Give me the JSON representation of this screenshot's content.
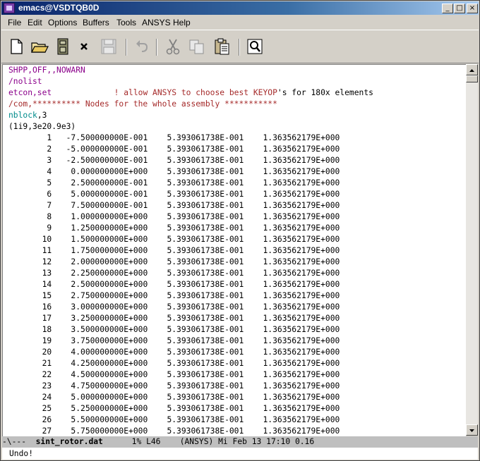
{
  "window": {
    "title": "emacs@VSDTQB0D"
  },
  "title_buttons": {
    "minimize": "_",
    "maximize": "□",
    "close": "×"
  },
  "menu": [
    "File",
    "Edit",
    "Options",
    "Buffers",
    "Tools",
    "ANSYS",
    "Help"
  ],
  "toolbar": [
    "new-file-icon",
    "open-folder-icon",
    "save-icon",
    "close-icon",
    "disk-icon",
    "undo-icon",
    "cut-icon",
    "copy-icon",
    "paste-icon",
    "search-icon"
  ],
  "colors": {
    "keyword": "#8b008b",
    "command": "#008b8b",
    "comment": "#a52a2a",
    "text": "#000000"
  },
  "header_lines": [
    {
      "parts": [
        {
          "t": "SHPP,OFF,,NOWARN",
          "c": "keyword"
        }
      ]
    },
    {
      "parts": [
        {
          "t": "/nolist",
          "c": "keyword"
        }
      ]
    },
    {
      "parts": [
        {
          "t": "etcon,set",
          "c": "keyword"
        },
        {
          "t": "             ! allow ANSYS to choose best KEYOP",
          "c": "comment"
        },
        {
          "t": "'s for 180x elements",
          "c": "text"
        }
      ]
    },
    {
      "parts": [
        {
          "t": "/com,********** Nodes for the whole assembly ***********",
          "c": "comment"
        }
      ]
    },
    {
      "parts": [
        {
          "t": "nblock",
          "c": "command"
        },
        {
          "t": ",3",
          "c": "text"
        }
      ]
    },
    {
      "parts": [
        {
          "t": "(1i9,3e20.9e3)",
          "c": "text"
        }
      ]
    }
  ],
  "nodes": [
    {
      "id": "1",
      "x": "-7.500000000E-001",
      "y": "5.393061738E-001",
      "z": "1.363562179E+000"
    },
    {
      "id": "2",
      "x": "-5.000000000E-001",
      "y": "5.393061738E-001",
      "z": "1.363562179E+000"
    },
    {
      "id": "3",
      "x": "-2.500000000E-001",
      "y": "5.393061738E-001",
      "z": "1.363562179E+000"
    },
    {
      "id": "4",
      "x": "0.000000000E+000",
      "y": "5.393061738E-001",
      "z": "1.363562179E+000"
    },
    {
      "id": "5",
      "x": "2.500000000E-001",
      "y": "5.393061738E-001",
      "z": "1.363562179E+000"
    },
    {
      "id": "6",
      "x": "5.000000000E-001",
      "y": "5.393061738E-001",
      "z": "1.363562179E+000"
    },
    {
      "id": "7",
      "x": "7.500000000E-001",
      "y": "5.393061738E-001",
      "z": "1.363562179E+000"
    },
    {
      "id": "8",
      "x": "1.000000000E+000",
      "y": "5.393061738E-001",
      "z": "1.363562179E+000"
    },
    {
      "id": "9",
      "x": "1.250000000E+000",
      "y": "5.393061738E-001",
      "z": "1.363562179E+000"
    },
    {
      "id": "10",
      "x": "1.500000000E+000",
      "y": "5.393061738E-001",
      "z": "1.363562179E+000"
    },
    {
      "id": "11",
      "x": "1.750000000E+000",
      "y": "5.393061738E-001",
      "z": "1.363562179E+000"
    },
    {
      "id": "12",
      "x": "2.000000000E+000",
      "y": "5.393061738E-001",
      "z": "1.363562179E+000"
    },
    {
      "id": "13",
      "x": "2.250000000E+000",
      "y": "5.393061738E-001",
      "z": "1.363562179E+000"
    },
    {
      "id": "14",
      "x": "2.500000000E+000",
      "y": "5.393061738E-001",
      "z": "1.363562179E+000"
    },
    {
      "id": "15",
      "x": "2.750000000E+000",
      "y": "5.393061738E-001",
      "z": "1.363562179E+000"
    },
    {
      "id": "16",
      "x": "3.000000000E+000",
      "y": "5.393061738E-001",
      "z": "1.363562179E+000"
    },
    {
      "id": "17",
      "x": "3.250000000E+000",
      "y": "5.393061738E-001",
      "z": "1.363562179E+000"
    },
    {
      "id": "18",
      "x": "3.500000000E+000",
      "y": "5.393061738E-001",
      "z": "1.363562179E+000"
    },
    {
      "id": "19",
      "x": "3.750000000E+000",
      "y": "5.393061738E-001",
      "z": "1.363562179E+000"
    },
    {
      "id": "20",
      "x": "4.000000000E+000",
      "y": "5.393061738E-001",
      "z": "1.363562179E+000"
    },
    {
      "id": "21",
      "x": "4.250000000E+000",
      "y": "5.393061738E-001",
      "z": "1.363562179E+000"
    },
    {
      "id": "22",
      "x": "4.500000000E+000",
      "y": "5.393061738E-001",
      "z": "1.363562179E+000"
    },
    {
      "id": "23",
      "x": "4.750000000E+000",
      "y": "5.393061738E-001",
      "z": "1.363562179E+000"
    },
    {
      "id": "24",
      "x": "5.000000000E+000",
      "y": "5.393061738E-001",
      "z": "1.363562179E+000"
    },
    {
      "id": "25",
      "x": "5.250000000E+000",
      "y": "5.393061738E-001",
      "z": "1.363562179E+000"
    },
    {
      "id": "26",
      "x": "5.500000000E+000",
      "y": "5.393061738E-001",
      "z": "1.363562179E+000"
    },
    {
      "id": "27",
      "x": "5.750000000E+000",
      "y": "5.393061738E-001",
      "z": "1.363562179E+000"
    }
  ],
  "modeline": {
    "status": "-\\---",
    "buffer": "sint_rotor.dat",
    "position": "1%",
    "line": "L46",
    "mode": "(ANSYS)",
    "datetime": "Mi Feb 13 17:10 0.16"
  },
  "minibuffer": "Undo!"
}
